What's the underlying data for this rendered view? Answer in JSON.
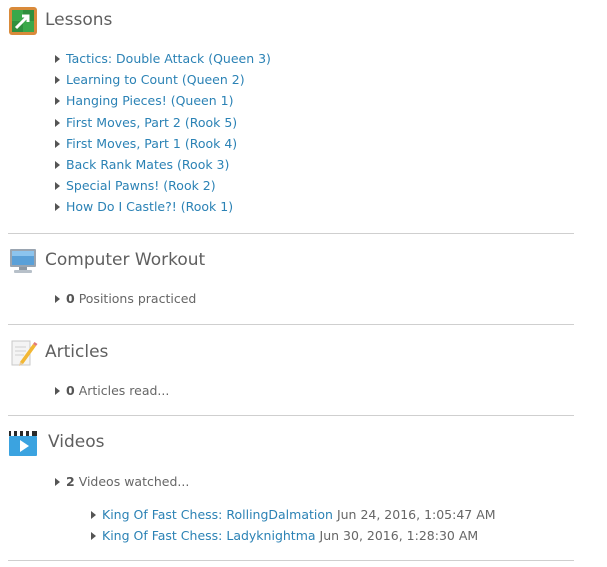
{
  "lessons": {
    "title": "Lessons",
    "items": [
      {
        "label": "Tactics: Double Attack (Queen 3)"
      },
      {
        "label": "Learning to Count (Queen 2)"
      },
      {
        "label": "Hanging Pieces! (Queen 1)"
      },
      {
        "label": "First Moves, Part 2 (Rook 5)"
      },
      {
        "label": "First Moves, Part 1 (Rook 4)"
      },
      {
        "label": "Back Rank Mates (Rook 3)"
      },
      {
        "label": "Special Pawns! (Rook 2)"
      },
      {
        "label": "How Do I Castle?! (Rook 1)"
      }
    ]
  },
  "computer_workout": {
    "title": "Computer Workout",
    "count": "0",
    "text": "Positions practiced"
  },
  "articles": {
    "title": "Articles",
    "count": "0",
    "text": "Articles read..."
  },
  "videos": {
    "title": "Videos",
    "count": "2",
    "text": "Videos watched...",
    "items": [
      {
        "label": "King Of Fast Chess: RollingDalmation",
        "date": "Jun 24, 2016, 1:05:47 AM"
      },
      {
        "label": "King Of Fast Chess: Ladyknightma",
        "date": "Jun 30, 2016, 1:28:30 AM"
      }
    ]
  },
  "colors": {
    "link": "#2b82b5",
    "heading": "#5f5f5f",
    "divider": "#cfcfcf"
  },
  "icons": {
    "lessons": "lesson-board-icon",
    "computer": "computer-monitor-icon",
    "articles": "pencil-paper-icon",
    "videos": "video-clapper-icon"
  }
}
